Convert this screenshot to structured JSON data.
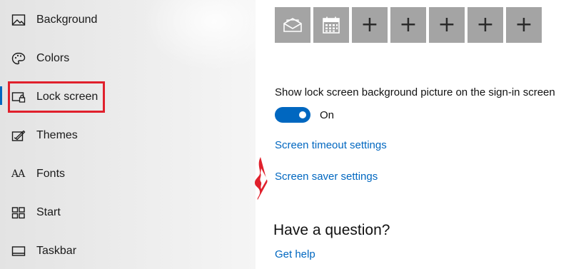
{
  "sidebar": {
    "items": [
      {
        "label": "Background",
        "icon": "background-icon"
      },
      {
        "label": "Colors",
        "icon": "palette-icon"
      },
      {
        "label": "Lock screen",
        "icon": "lock-screen-icon",
        "selected": true
      },
      {
        "label": "Themes",
        "icon": "themes-icon"
      },
      {
        "label": "Fonts",
        "icon": "fonts-icon",
        "icon_text": "AA"
      },
      {
        "label": "Start",
        "icon": "start-icon"
      },
      {
        "label": "Taskbar",
        "icon": "taskbar-icon"
      }
    ]
  },
  "main": {
    "quick_status_apps": [
      {
        "icon": "mail-icon"
      },
      {
        "icon": "calendar-icon"
      },
      {
        "icon": "plus-icon",
        "label": "+"
      },
      {
        "icon": "plus-icon",
        "label": "+"
      },
      {
        "icon": "plus-icon",
        "label": "+"
      },
      {
        "icon": "plus-icon",
        "label": "+"
      },
      {
        "icon": "plus-icon",
        "label": "+"
      }
    ],
    "signin_background_label": "Show lock screen background picture on the sign-in screen",
    "signin_background_toggle": {
      "state": "On",
      "on": true
    },
    "screen_timeout_link": "Screen timeout settings",
    "screen_saver_link": "Screen saver settings",
    "question_heading": "Have a question?",
    "get_help_link": "Get help"
  },
  "colors": {
    "accent": "#0067c0",
    "annotation_red": "#e0202c",
    "tile_gray": "#a4a4a4"
  }
}
